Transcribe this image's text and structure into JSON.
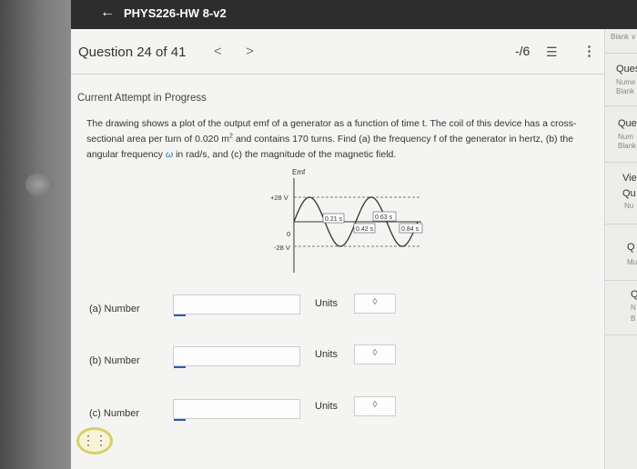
{
  "app": {
    "title": "PHYS226-HW 8-v2"
  },
  "header": {
    "question_label": "Question 24 of 41",
    "prev_symbol": "<",
    "next_symbol": ">",
    "score": "-/6"
  },
  "status": "Current Attempt in Progress",
  "problem": {
    "text_a": "The drawing shows a plot of the output emf of a generator as a function of time t. The coil of this device has a cross-sectional area per turn of 0.020 m",
    "text_sup": "2",
    "text_b": " and contains 170 turns. Find (a) the frequency f of the generator in hertz, (b) the angular frequency ",
    "omega": "ω",
    "text_c": " in rad/s, and (c) the magnitude of the magnetic field."
  },
  "graph": {
    "ylabel": "Emf",
    "y_top": "+28 V",
    "y_zero": "0",
    "y_bottom": "-28 V",
    "t1": "0.21 s",
    "t2": "0.42 s",
    "t3": "0.63 s",
    "t4": "0.84 s"
  },
  "chart_data": {
    "type": "line",
    "xlabel": "",
    "ylabel": "Emf",
    "x": [
      0,
      0.21,
      0.42,
      0.63,
      0.84
    ],
    "ylim": [
      -28,
      28
    ]
  },
  "answers": [
    {
      "label": "(a)   Number",
      "units_label": "Units",
      "value": ""
    },
    {
      "label": "(b)   Number",
      "units_label": "Units",
      "value": ""
    },
    {
      "label": "(c)   Number",
      "units_label": "Units",
      "value": ""
    }
  ],
  "info_symbol": "i",
  "select_symbol": "◊",
  "side_panel": {
    "top": "Blank ∨",
    "items": [
      {
        "head": "Ques",
        "sub1": "Nume",
        "sub2": "Blank"
      },
      {
        "head": "Que",
        "sub1": "Num",
        "sub2": "Blank"
      },
      {
        "head": "Vie",
        "sub1": "Qu",
        "sub2": "Nu"
      },
      {
        "head": "Q",
        "sub1": "Mu",
        "sub2": ""
      },
      {
        "head": "Q",
        "sub1": "N",
        "sub2": "B"
      }
    ]
  },
  "help_badge": "⋮⋮"
}
